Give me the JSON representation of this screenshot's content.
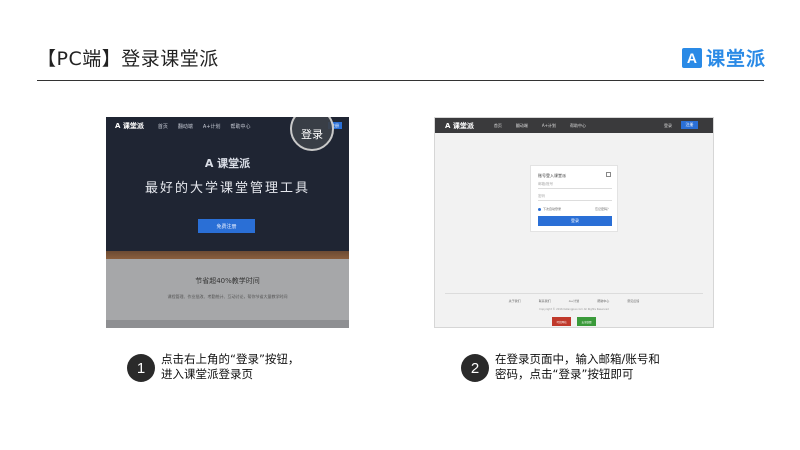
{
  "header": {
    "title": "【PC端】登录课堂派",
    "brand_mark": "A",
    "brand_text": "课堂派"
  },
  "screenshot1": {
    "logo": "A 课堂派",
    "nav": [
      "首页",
      "翻动端",
      "A+计划",
      "帮助中心"
    ],
    "corner_button": "注册",
    "login_circle": "登录",
    "hero_logo": "A 课堂派",
    "headline": "最好的大学课堂管理工具",
    "cta": "免费注册",
    "lower_title": "节省超40%教学时间",
    "lower_text": "课程管理、作业批改、考勤统计、互动讨论，帮你节省大量教学时间"
  },
  "screenshot2": {
    "logo": "A 课堂派",
    "nav": [
      "首页",
      "翻动端",
      "A+计划",
      "帮助中心"
    ],
    "nav_login": "登录",
    "nav_register": "注册",
    "card": {
      "title": "账号登入课堂派",
      "email_placeholder": "邮箱/账号",
      "password_placeholder": "密码",
      "remember": "下次自动登录",
      "forgot": "忘记密码？",
      "submit": "登录"
    },
    "footer_links": [
      "关于我们",
      "联系我们",
      "A+计划",
      "帮助中心",
      "意见反馈"
    ],
    "copyright": "Copyright © 2016 Ketangpai.com All Rights Reserved",
    "badges": [
      "可信网站",
      "安全联盟"
    ]
  },
  "steps": [
    {
      "number": "1",
      "line1": "点击右上角的“登录”按钮，",
      "line2": "进入课堂派登录页"
    },
    {
      "number": "2",
      "line1": "在登录页面中，输入邮箱/账号和",
      "line2": "密码，点击“登录”按钮即可"
    }
  ]
}
